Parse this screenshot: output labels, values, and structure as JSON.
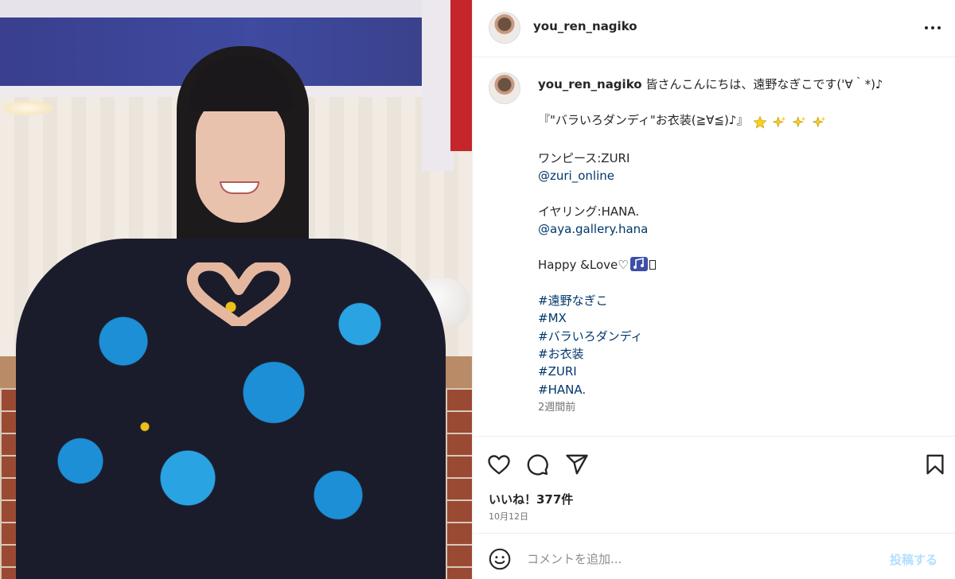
{
  "post": {
    "username": "you_ren_nagiko",
    "more_icon": "more-horizontal-icon"
  },
  "caption": {
    "username": "you_ren_nagiko",
    "lines": {
      "l1": " 皆さんこんにちは、遠野なぎこです('∀｀*)♪",
      "l2": "『\"バラいろダンディ\"お衣装(≧∀≦)♪』",
      "l3": "ワンピース:ZURI",
      "l4": "@zuri_online",
      "l5": "イヤリング:HANA.",
      "l6": "@aya.gallery.hana",
      "l7": "Happy &Love♡"
    },
    "hashtags": [
      "#遠野なぎこ",
      "#MX",
      "#バラいろダンディ",
      "#お衣装",
      "#ZURI",
      "#HANA."
    ],
    "time_ago": "2週間前",
    "emoji_icons": [
      "star-emoji",
      "sparkles-emoji",
      "sparkles-emoji",
      "sparkles-emoji",
      "musical-notes-emoji"
    ]
  },
  "actions": {
    "icons": [
      "heart-icon",
      "comment-icon",
      "share-icon",
      "bookmark-icon"
    ]
  },
  "likes": "いいね！377件",
  "date": "10月12日",
  "comment": {
    "placeholder": "コメントを追加...",
    "post_label": "投稿する",
    "emoji_icon": "smiley-icon"
  },
  "colors": {
    "link": "#00376b",
    "text": "#262626",
    "muted": "#737373",
    "post_button_disabled": "#b2dffc"
  }
}
